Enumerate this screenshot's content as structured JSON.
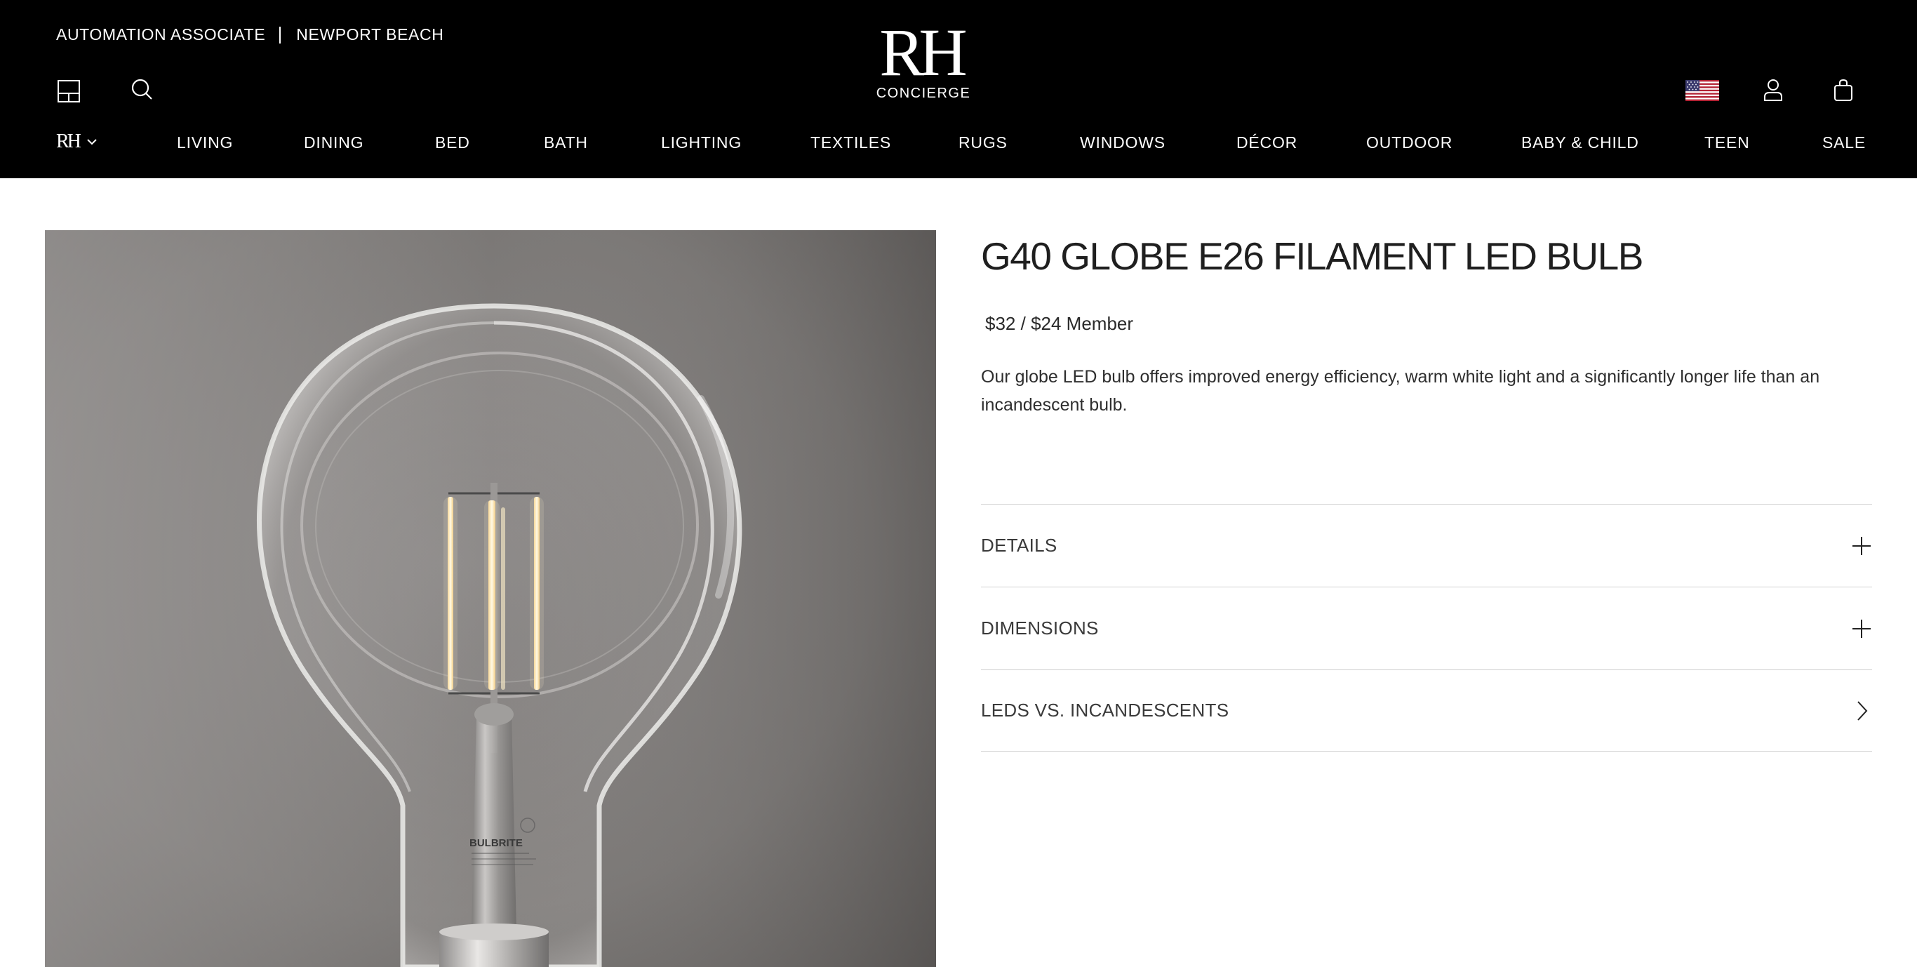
{
  "header": {
    "associate": "AUTOMATION ASSOCIATE",
    "location": "NEWPORT BEACH",
    "logo_mark": "RH",
    "logo_sub": "CONCIERGE",
    "nav_brand": "RH",
    "nav": [
      "LIVING",
      "DINING",
      "BED",
      "BATH",
      "LIGHTING",
      "TEXTILES",
      "RUGS",
      "WINDOWS",
      "DÉCOR",
      "OUTDOOR",
      "BABY & CHILD",
      "TEEN",
      "SALE"
    ],
    "icons": {
      "left": [
        "gallery-icon",
        "search-icon"
      ],
      "right": [
        "us-flag-icon",
        "account-icon",
        "cart-icon"
      ]
    }
  },
  "product": {
    "title": "G40 GLOBE E26 FILAMENT LED BULB",
    "price_regular": "$32",
    "price_separator": " / ",
    "price_member": "$24 Member",
    "description": "Our globe LED bulb offers improved energy efficiency, warm white light and a significantly longer life than an incandescent bulb.",
    "image_label": "BULBRITE"
  },
  "accordion": [
    {
      "label": "DETAILS",
      "icon": "plus-icon"
    },
    {
      "label": "DIMENSIONS",
      "icon": "plus-icon"
    },
    {
      "label": "LEDS VS. INCANDESCENTS",
      "icon": "chevron-right-icon"
    }
  ],
  "colors": {
    "header_bg": "#000000",
    "header_text": "#ffffff",
    "page_bg": "#ffffff",
    "divider": "#d0d0d0"
  }
}
